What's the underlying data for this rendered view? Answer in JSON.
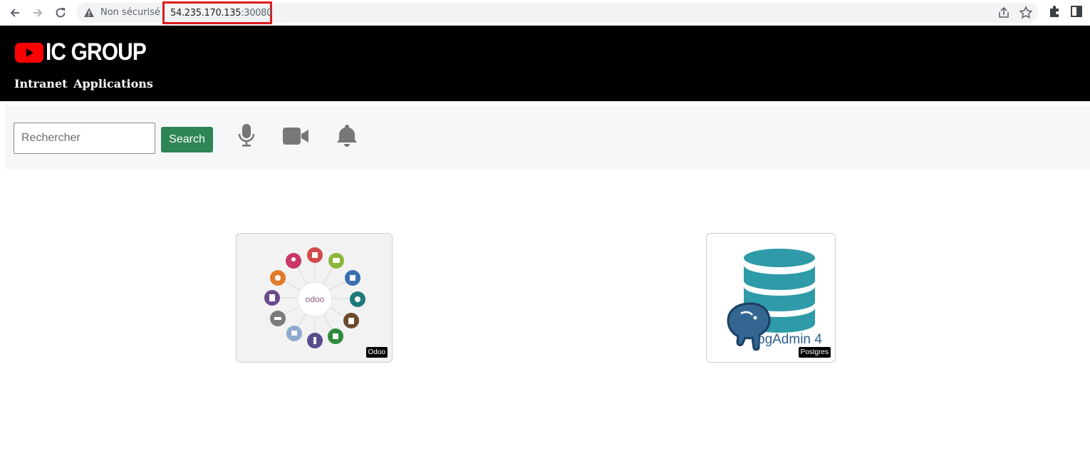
{
  "browser": {
    "security_text": "Non sécurisé",
    "url_host": "54.235.170.135",
    "url_port": ":30080"
  },
  "header": {
    "brand": "IC GROUP",
    "tagline": "Intranet  Applications"
  },
  "toolbar": {
    "search_placeholder": "Rechercher",
    "search_button": "Search",
    "icons": [
      "microphone-icon",
      "video-camera-icon",
      "bell-icon"
    ]
  },
  "apps": [
    {
      "badge": "Odoo",
      "center_text": "odoo"
    },
    {
      "badge": "Postgres",
      "label": "pgAdmin 4"
    }
  ],
  "colors": {
    "header_bg": "#000000",
    "search_button_bg": "#2e8555",
    "url_highlight": "#e01b1b",
    "postgres_teal": "#2f9aa8",
    "postgres_blue": "#336791"
  }
}
